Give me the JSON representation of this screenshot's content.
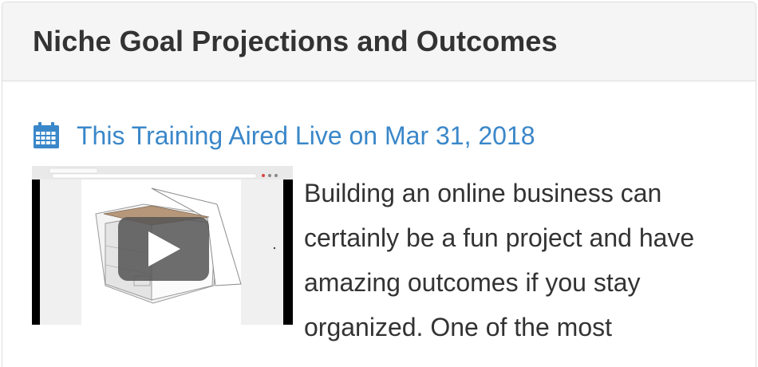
{
  "card": {
    "title": "Niche Goal Projections and Outcomes",
    "aired_text": "This Training Aired Live on Mar 31, 2018",
    "summary": "Building an online business can certainly be a fun project and have amazing outcomes if you stay organized. One of the most"
  },
  "icons": {
    "calendar": "calendar-icon",
    "play": "play-icon"
  },
  "colors": {
    "link": "#3a87c9",
    "header_bg": "#f5f5f5",
    "text": "#333333"
  }
}
